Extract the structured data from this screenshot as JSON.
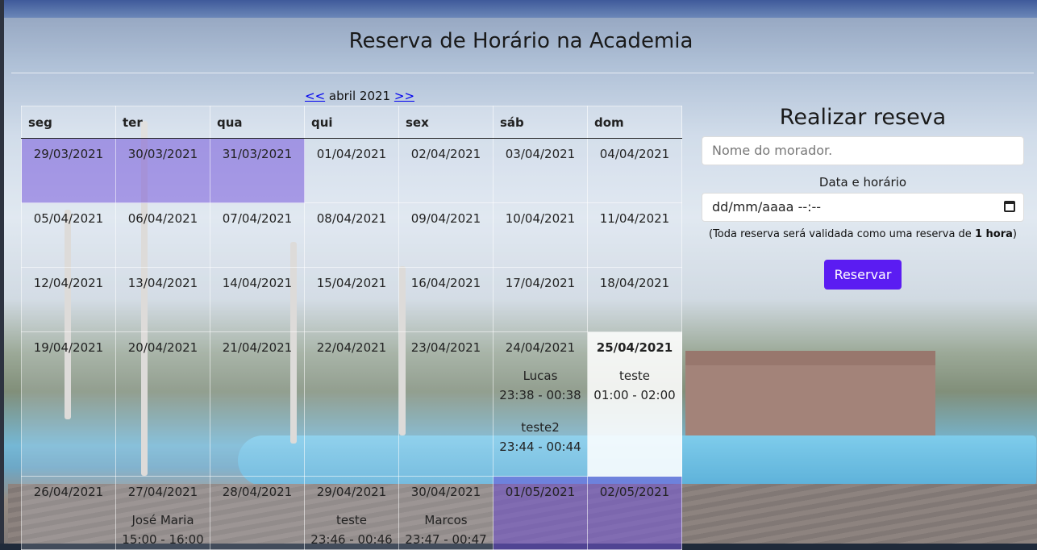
{
  "page": {
    "title": "Reserva de Horário na Academia"
  },
  "calendar": {
    "prev_link": "<<",
    "month_label": "abril 2021",
    "next_link": ">>",
    "weekdays": [
      "seg",
      "ter",
      "qua",
      "qui",
      "sex",
      "sáb",
      "dom"
    ],
    "weeks": [
      [
        {
          "date": "29/03/2021",
          "other_month": true,
          "bookings": []
        },
        {
          "date": "30/03/2021",
          "other_month": true,
          "bookings": []
        },
        {
          "date": "31/03/2021",
          "other_month": true,
          "bookings": []
        },
        {
          "date": "01/04/2021",
          "bookings": []
        },
        {
          "date": "02/04/2021",
          "bookings": []
        },
        {
          "date": "03/04/2021",
          "bookings": []
        },
        {
          "date": "04/04/2021",
          "bookings": []
        }
      ],
      [
        {
          "date": "05/04/2021",
          "bookings": []
        },
        {
          "date": "06/04/2021",
          "bookings": []
        },
        {
          "date": "07/04/2021",
          "bookings": []
        },
        {
          "date": "08/04/2021",
          "bookings": []
        },
        {
          "date": "09/04/2021",
          "bookings": []
        },
        {
          "date": "10/04/2021",
          "bookings": []
        },
        {
          "date": "11/04/2021",
          "bookings": []
        }
      ],
      [
        {
          "date": "12/04/2021",
          "bookings": []
        },
        {
          "date": "13/04/2021",
          "bookings": []
        },
        {
          "date": "14/04/2021",
          "bookings": []
        },
        {
          "date": "15/04/2021",
          "bookings": []
        },
        {
          "date": "16/04/2021",
          "bookings": []
        },
        {
          "date": "17/04/2021",
          "bookings": []
        },
        {
          "date": "18/04/2021",
          "bookings": []
        }
      ],
      [
        {
          "date": "19/04/2021",
          "bookings": []
        },
        {
          "date": "20/04/2021",
          "bookings": []
        },
        {
          "date": "21/04/2021",
          "bookings": []
        },
        {
          "date": "22/04/2021",
          "bookings": []
        },
        {
          "date": "23/04/2021",
          "bookings": []
        },
        {
          "date": "24/04/2021",
          "bookings": [
            {
              "name": "Lucas",
              "time": "23:38 - 00:38"
            },
            {
              "name": "teste2",
              "time": "23:44 - 00:44"
            }
          ]
        },
        {
          "date": "25/04/2021",
          "today": true,
          "bookings": [
            {
              "name": "teste",
              "time": "01:00 - 02:00"
            }
          ]
        }
      ],
      [
        {
          "date": "26/04/2021",
          "bookings": []
        },
        {
          "date": "27/04/2021",
          "bookings": [
            {
              "name": "José Maria",
              "time": "15:00 - 16:00"
            }
          ]
        },
        {
          "date": "28/04/2021",
          "bookings": []
        },
        {
          "date": "29/04/2021",
          "bookings": [
            {
              "name": "teste",
              "time": "23:46 - 00:46"
            }
          ]
        },
        {
          "date": "30/04/2021",
          "bookings": [
            {
              "name": "Marcos",
              "time": "23:47 - 00:47"
            }
          ]
        },
        {
          "date": "01/05/2021",
          "other_month": true,
          "bookings": []
        },
        {
          "date": "02/05/2021",
          "other_month": true,
          "bookings": []
        }
      ]
    ]
  },
  "form": {
    "heading": "Realizar reseva",
    "name_placeholder": "Nome do morador.",
    "datetime_label": "Data e horário",
    "datetime_value": "dd/mm/aaaa --:--",
    "note_prefix": "(Toda reserva será validada como uma reserva de ",
    "note_bold": "1 hora",
    "note_suffix": ")",
    "submit_label": "Reservar"
  },
  "colors": {
    "accent": "#5b1cf2",
    "other_month": "#7a5adc",
    "link": "#0000ee"
  }
}
